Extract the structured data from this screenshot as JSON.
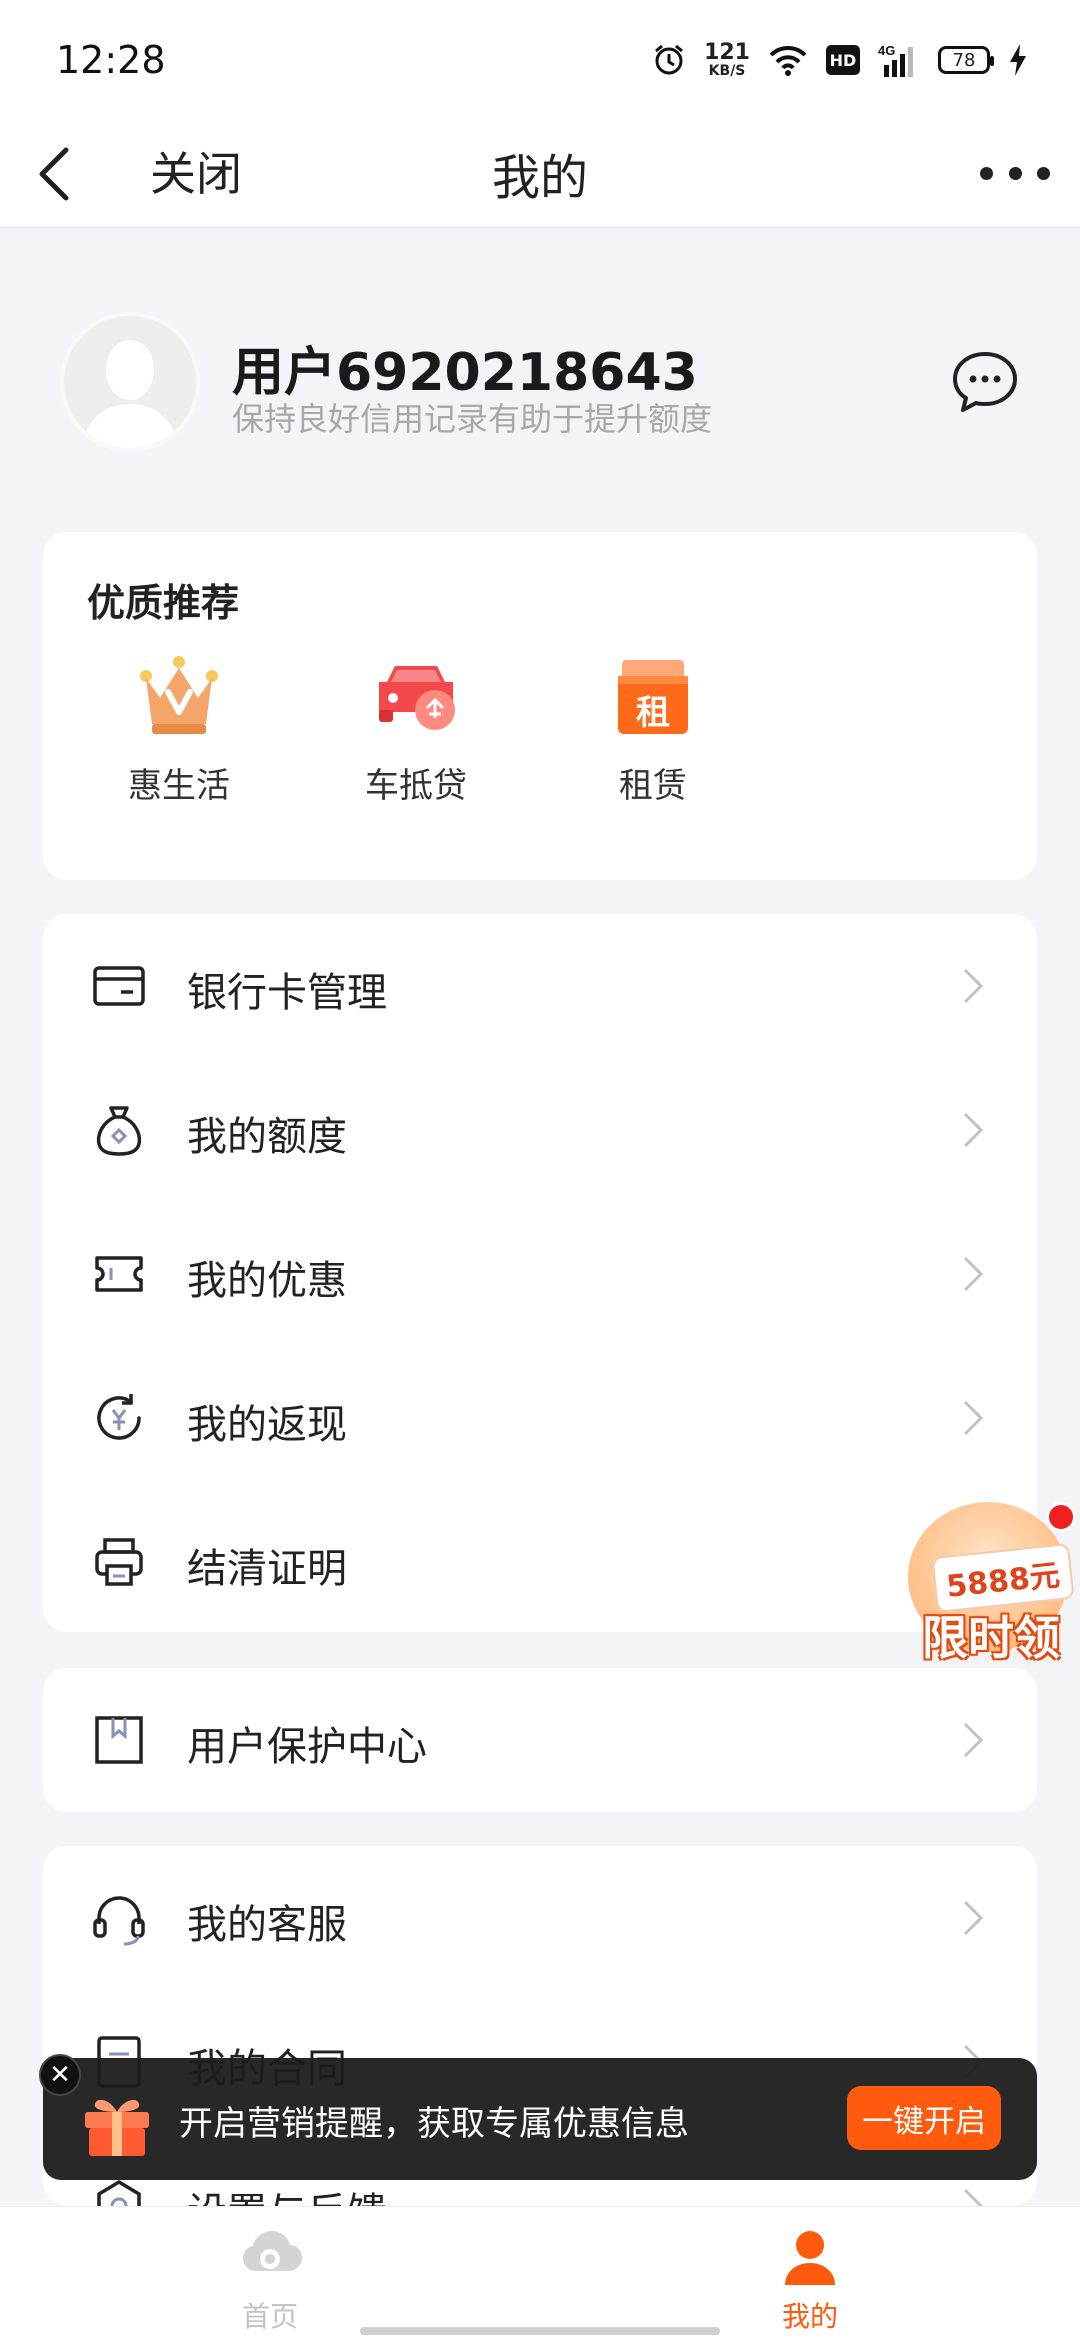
{
  "status_bar": {
    "time": "12:28",
    "net_speed": "121",
    "net_unit": "KB/S",
    "hd": "HD",
    "network": "4G",
    "battery": "78"
  },
  "nav": {
    "close_label": "关闭",
    "title": "我的"
  },
  "profile": {
    "username": "用户6920218643",
    "subtitle": "保持良好信用记录有助于提升额度"
  },
  "recommend": {
    "title": "优质推荐",
    "items": [
      {
        "label": "惠生活",
        "icon": "crown-icon"
      },
      {
        "label": "车抵贷",
        "icon": "car-loan-icon"
      },
      {
        "label": "租赁",
        "icon": "lease-box-icon",
        "icon_text": "租"
      }
    ]
  },
  "menu_group_1": [
    {
      "label": "银行卡管理",
      "icon": "bank-card-icon"
    },
    {
      "label": "我的额度",
      "icon": "money-bag-icon"
    },
    {
      "label": "我的优惠",
      "icon": "coupon-icon"
    },
    {
      "label": "我的返现",
      "icon": "cashback-icon"
    },
    {
      "label": "结清证明",
      "icon": "printer-icon"
    }
  ],
  "menu_group_2": [
    {
      "label": "用户保护中心",
      "icon": "bookmark-box-icon"
    }
  ],
  "menu_group_3": [
    {
      "label": "我的客服",
      "icon": "headset-icon"
    },
    {
      "label": "我的合同",
      "icon": "contract-icon"
    },
    {
      "label": "设置与反馈",
      "icon": "settings-icon"
    }
  ],
  "promo": {
    "amount": "5888元",
    "text": "限时领"
  },
  "toast": {
    "close": "✕",
    "message": "开启营销提醒，获取专属优惠信息",
    "button": "一键开启"
  },
  "tabs": [
    {
      "label": "首页",
      "active": false
    },
    {
      "label": "我的",
      "active": true
    }
  ],
  "colors": {
    "accent": "#ff5a0d",
    "tab_active": "#ff5a0d",
    "tab_inactive": "#c4c4c4",
    "background": "#f3f4f7"
  }
}
